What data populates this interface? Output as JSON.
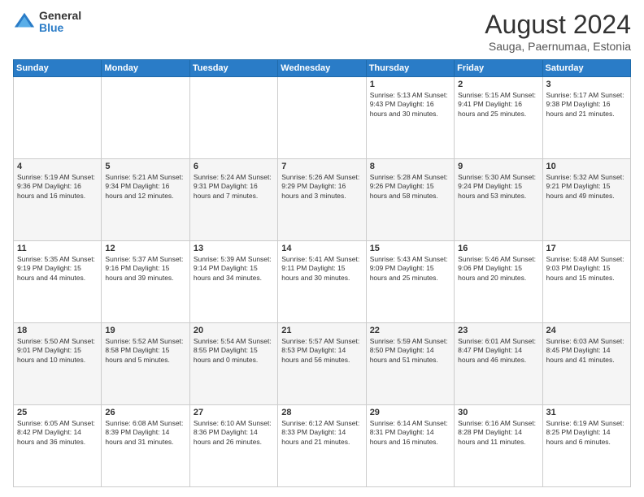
{
  "header": {
    "logo_general": "General",
    "logo_blue": "Blue",
    "title": "August 2024",
    "subtitle": "Sauga, Paernumaa, Estonia"
  },
  "weekdays": [
    "Sunday",
    "Monday",
    "Tuesday",
    "Wednesday",
    "Thursday",
    "Friday",
    "Saturday"
  ],
  "weeks": [
    [
      {
        "day": "",
        "info": ""
      },
      {
        "day": "",
        "info": ""
      },
      {
        "day": "",
        "info": ""
      },
      {
        "day": "",
        "info": ""
      },
      {
        "day": "1",
        "info": "Sunrise: 5:13 AM\nSunset: 9:43 PM\nDaylight: 16 hours\nand 30 minutes."
      },
      {
        "day": "2",
        "info": "Sunrise: 5:15 AM\nSunset: 9:41 PM\nDaylight: 16 hours\nand 25 minutes."
      },
      {
        "day": "3",
        "info": "Sunrise: 5:17 AM\nSunset: 9:38 PM\nDaylight: 16 hours\nand 21 minutes."
      }
    ],
    [
      {
        "day": "4",
        "info": "Sunrise: 5:19 AM\nSunset: 9:36 PM\nDaylight: 16 hours\nand 16 minutes."
      },
      {
        "day": "5",
        "info": "Sunrise: 5:21 AM\nSunset: 9:34 PM\nDaylight: 16 hours\nand 12 minutes."
      },
      {
        "day": "6",
        "info": "Sunrise: 5:24 AM\nSunset: 9:31 PM\nDaylight: 16 hours\nand 7 minutes."
      },
      {
        "day": "7",
        "info": "Sunrise: 5:26 AM\nSunset: 9:29 PM\nDaylight: 16 hours\nand 3 minutes."
      },
      {
        "day": "8",
        "info": "Sunrise: 5:28 AM\nSunset: 9:26 PM\nDaylight: 15 hours\nand 58 minutes."
      },
      {
        "day": "9",
        "info": "Sunrise: 5:30 AM\nSunset: 9:24 PM\nDaylight: 15 hours\nand 53 minutes."
      },
      {
        "day": "10",
        "info": "Sunrise: 5:32 AM\nSunset: 9:21 PM\nDaylight: 15 hours\nand 49 minutes."
      }
    ],
    [
      {
        "day": "11",
        "info": "Sunrise: 5:35 AM\nSunset: 9:19 PM\nDaylight: 15 hours\nand 44 minutes."
      },
      {
        "day": "12",
        "info": "Sunrise: 5:37 AM\nSunset: 9:16 PM\nDaylight: 15 hours\nand 39 minutes."
      },
      {
        "day": "13",
        "info": "Sunrise: 5:39 AM\nSunset: 9:14 PM\nDaylight: 15 hours\nand 34 minutes."
      },
      {
        "day": "14",
        "info": "Sunrise: 5:41 AM\nSunset: 9:11 PM\nDaylight: 15 hours\nand 30 minutes."
      },
      {
        "day": "15",
        "info": "Sunrise: 5:43 AM\nSunset: 9:09 PM\nDaylight: 15 hours\nand 25 minutes."
      },
      {
        "day": "16",
        "info": "Sunrise: 5:46 AM\nSunset: 9:06 PM\nDaylight: 15 hours\nand 20 minutes."
      },
      {
        "day": "17",
        "info": "Sunrise: 5:48 AM\nSunset: 9:03 PM\nDaylight: 15 hours\nand 15 minutes."
      }
    ],
    [
      {
        "day": "18",
        "info": "Sunrise: 5:50 AM\nSunset: 9:01 PM\nDaylight: 15 hours\nand 10 minutes."
      },
      {
        "day": "19",
        "info": "Sunrise: 5:52 AM\nSunset: 8:58 PM\nDaylight: 15 hours\nand 5 minutes."
      },
      {
        "day": "20",
        "info": "Sunrise: 5:54 AM\nSunset: 8:55 PM\nDaylight: 15 hours\nand 0 minutes."
      },
      {
        "day": "21",
        "info": "Sunrise: 5:57 AM\nSunset: 8:53 PM\nDaylight: 14 hours\nand 56 minutes."
      },
      {
        "day": "22",
        "info": "Sunrise: 5:59 AM\nSunset: 8:50 PM\nDaylight: 14 hours\nand 51 minutes."
      },
      {
        "day": "23",
        "info": "Sunrise: 6:01 AM\nSunset: 8:47 PM\nDaylight: 14 hours\nand 46 minutes."
      },
      {
        "day": "24",
        "info": "Sunrise: 6:03 AM\nSunset: 8:45 PM\nDaylight: 14 hours\nand 41 minutes."
      }
    ],
    [
      {
        "day": "25",
        "info": "Sunrise: 6:05 AM\nSunset: 8:42 PM\nDaylight: 14 hours\nand 36 minutes."
      },
      {
        "day": "26",
        "info": "Sunrise: 6:08 AM\nSunset: 8:39 PM\nDaylight: 14 hours\nand 31 minutes."
      },
      {
        "day": "27",
        "info": "Sunrise: 6:10 AM\nSunset: 8:36 PM\nDaylight: 14 hours\nand 26 minutes."
      },
      {
        "day": "28",
        "info": "Sunrise: 6:12 AM\nSunset: 8:33 PM\nDaylight: 14 hours\nand 21 minutes."
      },
      {
        "day": "29",
        "info": "Sunrise: 6:14 AM\nSunset: 8:31 PM\nDaylight: 14 hours\nand 16 minutes."
      },
      {
        "day": "30",
        "info": "Sunrise: 6:16 AM\nSunset: 8:28 PM\nDaylight: 14 hours\nand 11 minutes."
      },
      {
        "day": "31",
        "info": "Sunrise: 6:19 AM\nSunset: 8:25 PM\nDaylight: 14 hours\nand 6 minutes."
      }
    ]
  ]
}
